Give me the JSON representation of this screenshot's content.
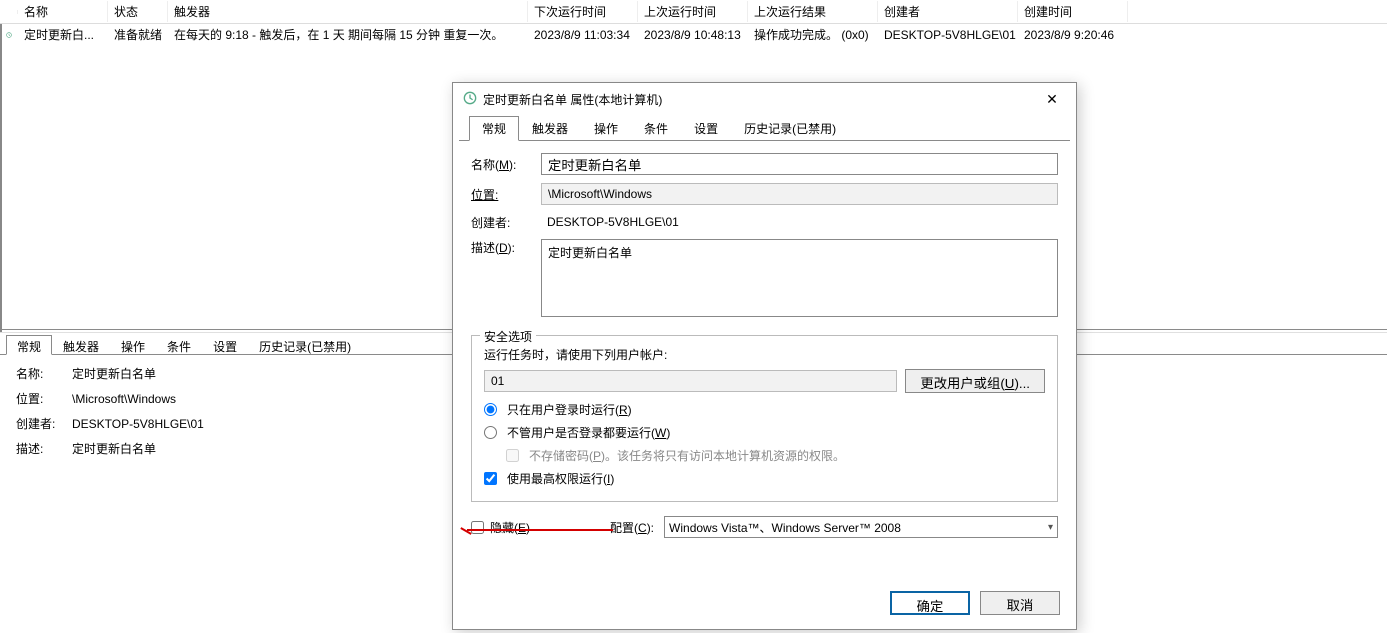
{
  "grid": {
    "headers": {
      "name": "名称",
      "status": "状态",
      "trigger": "触发器",
      "next": "下次运行时间",
      "last": "上次运行时间",
      "result": "上次运行结果",
      "author": "创建者",
      "created": "创建时间"
    },
    "row": {
      "name": "定时更新白...",
      "status": "准备就绪",
      "trigger": "在每天的 9:18 - 触发后，在 1 天 期间每隔 15 分钟 重复一次。",
      "next": "2023/8/9 11:03:34",
      "last": "2023/8/9 10:48:13",
      "result": "操作成功完成。 (0x0)",
      "author": "DESKTOP-5V8HLGE\\01",
      "created": "2023/8/9 9:20:46"
    }
  },
  "bottom_tabs": [
    "常规",
    "触发器",
    "操作",
    "条件",
    "设置",
    "历史记录(已禁用)"
  ],
  "bottom_form": {
    "name_label": "名称:",
    "name_value": "定时更新白名单",
    "location_label": "位置:",
    "location_value": "\\Microsoft\\Windows",
    "author_label": "创建者:",
    "author_value": "DESKTOP-5V8HLGE\\01",
    "desc_label": "描述:",
    "desc_value": "定时更新白名单"
  },
  "dialog": {
    "title": "定时更新白名单 属性(本地计算机)",
    "tabs": [
      "常规",
      "触发器",
      "操作",
      "条件",
      "设置",
      "历史记录(已禁用)"
    ],
    "name_label": "名称(M):",
    "name_value": "定时更新白名单",
    "location_label": "位置:",
    "location_value": "\\Microsoft\\Windows",
    "author_label": "创建者:",
    "author_value": "DESKTOP-5V8HLGE\\01",
    "desc_label": "描述(D):",
    "desc_value": "定时更新白名单",
    "security_legend": "安全选项",
    "security_prompt": "运行任务时，请使用下列用户帐户:",
    "account_value": "01",
    "change_user_btn": "更改用户或组(U)...",
    "radio1": "只在用户登录时运行(R)",
    "radio2": "不管用户是否登录都要运行(W)",
    "no_pwd": "不存储密码(P)。该任务将只有访问本地计算机资源的权限。",
    "highest_priv": "使用最高权限运行(I)",
    "hidden_label": "隐藏(E)",
    "config_label": "配置(C):",
    "config_value": "Windows Vista™、Windows Server™ 2008",
    "ok_btn": "确定",
    "cancel_btn": "取消"
  }
}
